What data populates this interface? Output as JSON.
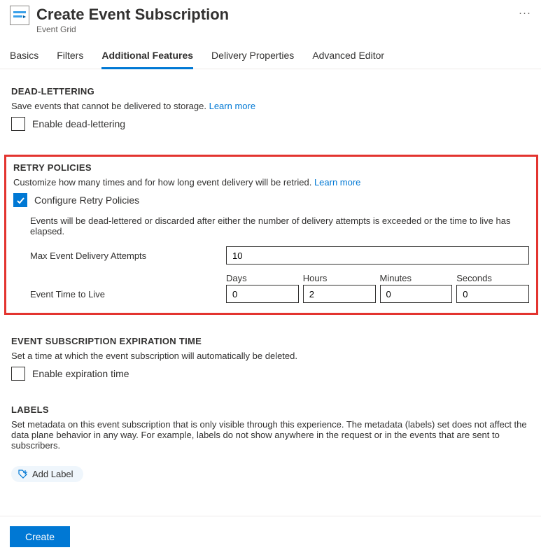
{
  "header": {
    "title": "Create Event Subscription",
    "subtitle": "Event Grid",
    "more": "···"
  },
  "tabs": [
    "Basics",
    "Filters",
    "Additional Features",
    "Delivery Properties",
    "Advanced Editor"
  ],
  "active_tab_index": 2,
  "sections": {
    "dead_lettering": {
      "heading": "DEAD-LETTERING",
      "desc": "Save events that cannot be delivered to storage.",
      "learn_more": "Learn more",
      "checkbox_label": "Enable dead-lettering",
      "checked": false
    },
    "retry_policies": {
      "heading": "RETRY POLICIES",
      "desc": "Customize how many times and for how long event delivery will be retried.",
      "learn_more": "Learn more",
      "checkbox_label": "Configure Retry Policies",
      "checked": true,
      "note": "Events will be dead-lettered or discarded after either the number of delivery attempts is exceeded or the time to live has elapsed.",
      "max_attempts_label": "Max Event Delivery Attempts",
      "max_attempts_value": "10",
      "ttl_label": "Event Time to Live",
      "ttl_headers": {
        "days": "Days",
        "hours": "Hours",
        "minutes": "Minutes",
        "seconds": "Seconds"
      },
      "ttl_values": {
        "days": "0",
        "hours": "2",
        "minutes": "0",
        "seconds": "0"
      }
    },
    "expiration": {
      "heading": "EVENT SUBSCRIPTION EXPIRATION TIME",
      "desc": "Set a time at which the event subscription will automatically be deleted.",
      "checkbox_label": "Enable expiration time",
      "checked": false
    },
    "labels": {
      "heading": "LABELS",
      "desc": "Set metadata on this event subscription that is only visible through this experience. The metadata (labels) set does not affect the data plane behavior in any way. For example, labels do not show anywhere in the request or in the events that are sent to subscribers.",
      "add_label": "Add Label"
    }
  },
  "footer": {
    "create_button": "Create"
  }
}
